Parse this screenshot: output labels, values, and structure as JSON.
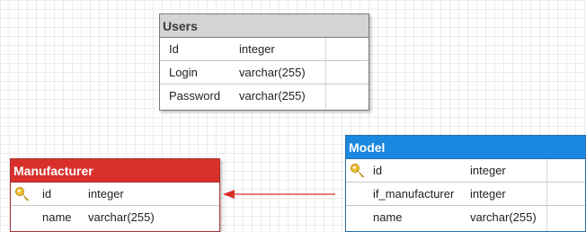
{
  "colors": {
    "users_header": "#d4d4d4",
    "model_header": "#1a87e0",
    "manufacturer_header": "#d9302c",
    "relation_line": "#d9302c"
  },
  "users": {
    "title": "Users",
    "rows": [
      {
        "name": "Id",
        "type": "integer"
      },
      {
        "name": "Login",
        "type": "varchar(255)"
      },
      {
        "name": "Password",
        "type": "varchar(255)"
      }
    ]
  },
  "model": {
    "title": "Model",
    "rows": [
      {
        "name": "id",
        "type": "integer",
        "icon": "key-icon"
      },
      {
        "name": "if_manufacturer",
        "type": "integer"
      },
      {
        "name": "name",
        "type": "varchar(255)"
      }
    ]
  },
  "manufacturer": {
    "title": "Manufacturer",
    "rows": [
      {
        "name": "id",
        "type": "integer",
        "icon": "key-icon"
      },
      {
        "name": "name",
        "type": "varchar(255)"
      }
    ]
  }
}
